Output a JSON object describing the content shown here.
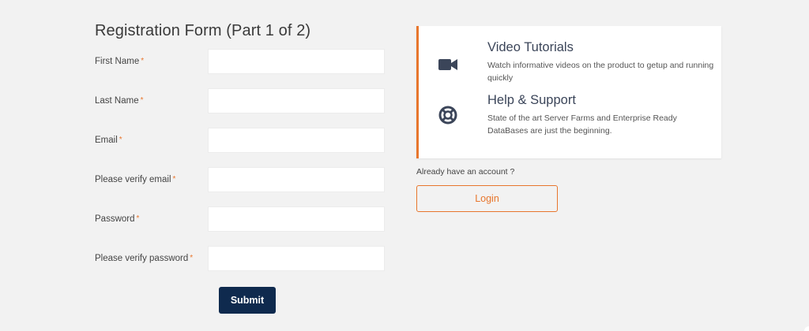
{
  "form": {
    "title": "Registration Form (Part 1 of 2)",
    "required_marker": "*",
    "fields": [
      {
        "label": "First Name",
        "value": ""
      },
      {
        "label": "Last Name",
        "value": ""
      },
      {
        "label": "Email",
        "value": ""
      },
      {
        "label": "Please verify email",
        "value": ""
      },
      {
        "label": "Password",
        "value": ""
      },
      {
        "label": "Please verify password",
        "value": ""
      }
    ],
    "submit_label": "Submit"
  },
  "info": {
    "items": [
      {
        "icon": "video-camera-icon",
        "title": "Video Tutorials",
        "description": "Watch informative videos on the product to getup and running quickly"
      },
      {
        "icon": "lifebuoy-icon",
        "title": "Help & Support",
        "description": "State of the art Server Farms and Enterprise Ready DataBases are just the beginning."
      }
    ]
  },
  "account": {
    "prompt": "Already have an account ?",
    "login_label": "Login"
  },
  "colors": {
    "accent": "#e8762d",
    "primary": "#0f2a4e",
    "background": "#f2f2f2",
    "icon": "#3b4559"
  }
}
